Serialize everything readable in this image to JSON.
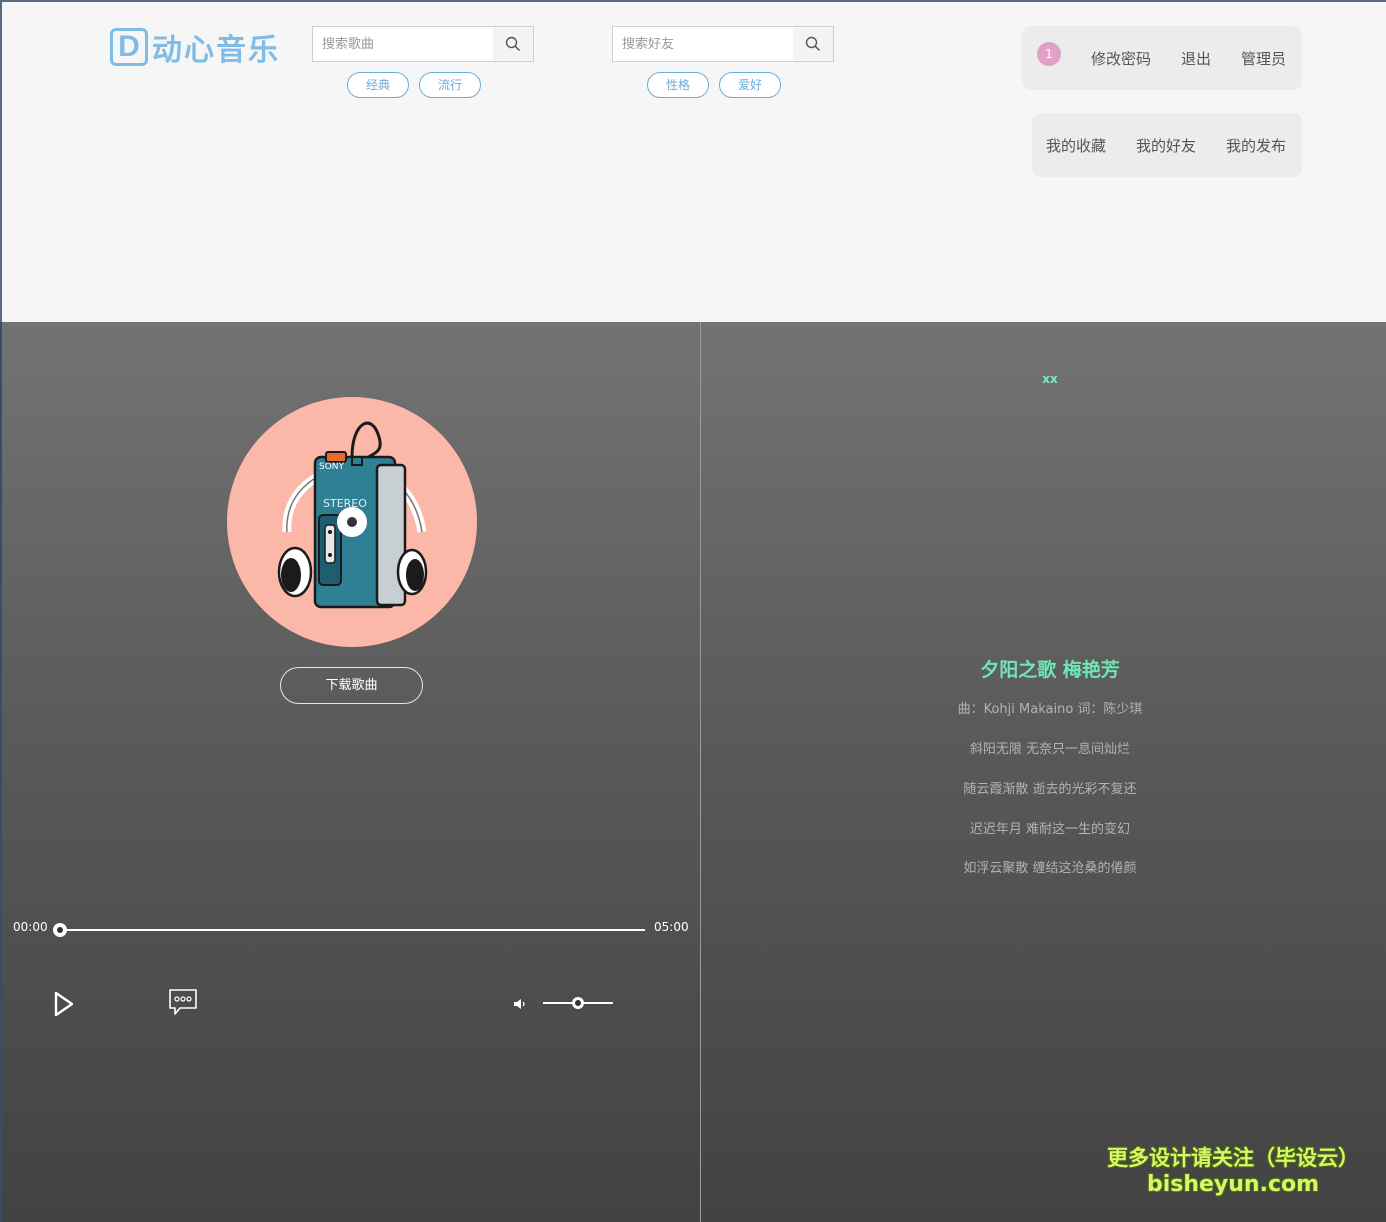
{
  "logo": {
    "letter": "D",
    "text": "动心音乐"
  },
  "song_search": {
    "placeholder": "搜索歌曲",
    "tags": [
      "经典",
      "流行"
    ]
  },
  "friend_search": {
    "placeholder": "搜索好友",
    "tags": [
      "性格",
      "爱好"
    ]
  },
  "user_menu": {
    "badge": "1",
    "change_password": "修改密码",
    "logout": "退出",
    "admin": "管理员"
  },
  "nav": {
    "favorites": "我的收藏",
    "friends": "我的好友",
    "posts": "我的发布"
  },
  "player": {
    "download_label": "下载歌曲",
    "time_current": "00:00",
    "time_total": "05:00",
    "progress": 0.0,
    "volume": 0.5
  },
  "lyrics": {
    "top_mark": "xx",
    "title": "夕阳之歌 梅艳芳",
    "lines": [
      "曲：Kohji Makaino 词：陈少琪",
      "斜阳无限 无奈只一息间灿烂",
      "随云霞渐散 逝去的光彩不复还",
      "迟迟年月 难耐这一生的变幻",
      "如浮云聚散 缠结这沧桑的倦颜"
    ]
  },
  "watermark": {
    "line1": "更多设计请关注（毕设云）",
    "line2": "bisheyun.com"
  },
  "colors": {
    "brand": "#7fbde6",
    "accent_green": "#6ee6b6",
    "badge": "#e0a0c8",
    "disc_bg": "#fbb7a8"
  }
}
